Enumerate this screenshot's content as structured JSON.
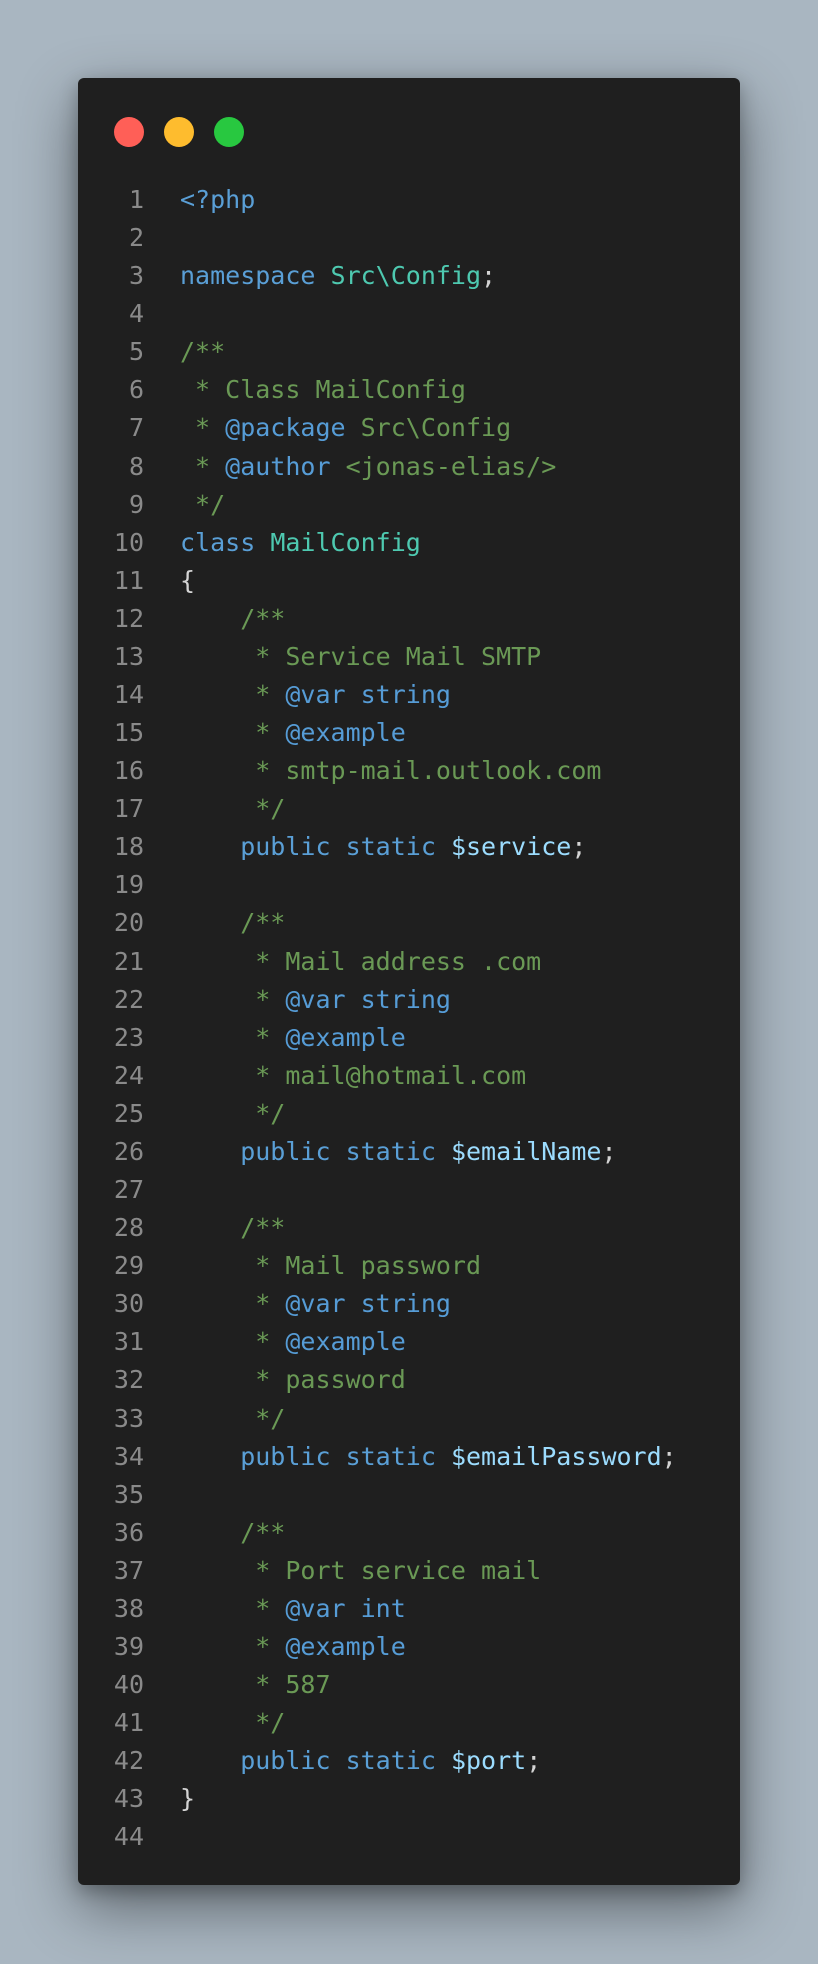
{
  "window": {
    "colors": {
      "page_background": "#a9b6c1",
      "editor_background": "#1f1f1f",
      "close": "#ff5f57",
      "minimize": "#febc2e",
      "zoom": "#28c840"
    }
  },
  "lines": [
    {
      "n": "1",
      "tokens": [
        {
          "t": "<?php",
          "c": "kw"
        }
      ]
    },
    {
      "n": "2",
      "tokens": []
    },
    {
      "n": "3",
      "tokens": [
        {
          "t": "namespace ",
          "c": "kw"
        },
        {
          "t": "Src\\Config",
          "c": "ns"
        },
        {
          "t": ";",
          "c": "pn"
        }
      ]
    },
    {
      "n": "4",
      "tokens": []
    },
    {
      "n": "5",
      "tokens": [
        {
          "t": "/**",
          "c": "cm"
        }
      ]
    },
    {
      "n": "6",
      "tokens": [
        {
          "t": " * Class MailConfig",
          "c": "cm"
        }
      ]
    },
    {
      "n": "7",
      "tokens": [
        {
          "t": " * ",
          "c": "cm"
        },
        {
          "t": "@package",
          "c": "tag"
        },
        {
          "t": " Src\\Config",
          "c": "cm"
        }
      ]
    },
    {
      "n": "8",
      "tokens": [
        {
          "t": " * ",
          "c": "cm"
        },
        {
          "t": "@author",
          "c": "tag"
        },
        {
          "t": " <jonas-elias/>",
          "c": "cm"
        }
      ]
    },
    {
      "n": "9",
      "tokens": [
        {
          "t": " */",
          "c": "cm"
        }
      ]
    },
    {
      "n": "10",
      "tokens": [
        {
          "t": "class ",
          "c": "kw"
        },
        {
          "t": "MailConfig",
          "c": "ns"
        }
      ]
    },
    {
      "n": "11",
      "tokens": [
        {
          "t": "{",
          "c": "pn"
        }
      ]
    },
    {
      "n": "12",
      "tokens": [
        {
          "t": "    /**",
          "c": "cm"
        }
      ]
    },
    {
      "n": "13",
      "tokens": [
        {
          "t": "     * Service Mail SMTP",
          "c": "cm"
        }
      ]
    },
    {
      "n": "14",
      "tokens": [
        {
          "t": "     * ",
          "c": "cm"
        },
        {
          "t": "@var",
          "c": "tag"
        },
        {
          "t": " string",
          "c": "tag"
        }
      ]
    },
    {
      "n": "15",
      "tokens": [
        {
          "t": "     * ",
          "c": "cm"
        },
        {
          "t": "@example",
          "c": "tag"
        }
      ]
    },
    {
      "n": "16",
      "tokens": [
        {
          "t": "     * smtp-mail.outlook.com",
          "c": "cm"
        }
      ]
    },
    {
      "n": "17",
      "tokens": [
        {
          "t": "     */",
          "c": "cm"
        }
      ]
    },
    {
      "n": "18",
      "tokens": [
        {
          "t": "    public static ",
          "c": "kw"
        },
        {
          "t": "$service",
          "c": "var"
        },
        {
          "t": ";",
          "c": "pn"
        }
      ]
    },
    {
      "n": "19",
      "tokens": []
    },
    {
      "n": "20",
      "tokens": [
        {
          "t": "    /**",
          "c": "cm"
        }
      ]
    },
    {
      "n": "21",
      "tokens": [
        {
          "t": "     * Mail address .com",
          "c": "cm"
        }
      ]
    },
    {
      "n": "22",
      "tokens": [
        {
          "t": "     * ",
          "c": "cm"
        },
        {
          "t": "@var",
          "c": "tag"
        },
        {
          "t": " string",
          "c": "tag"
        }
      ]
    },
    {
      "n": "23",
      "tokens": [
        {
          "t": "     * ",
          "c": "cm"
        },
        {
          "t": "@example",
          "c": "tag"
        }
      ]
    },
    {
      "n": "24",
      "tokens": [
        {
          "t": "     * mail@hotmail.com",
          "c": "cm"
        }
      ]
    },
    {
      "n": "25",
      "tokens": [
        {
          "t": "     */",
          "c": "cm"
        }
      ]
    },
    {
      "n": "26",
      "tokens": [
        {
          "t": "    public static ",
          "c": "kw"
        },
        {
          "t": "$emailName",
          "c": "var"
        },
        {
          "t": ";",
          "c": "pn"
        }
      ]
    },
    {
      "n": "27",
      "tokens": []
    },
    {
      "n": "28",
      "tokens": [
        {
          "t": "    /**",
          "c": "cm"
        }
      ]
    },
    {
      "n": "29",
      "tokens": [
        {
          "t": "     * Mail password",
          "c": "cm"
        }
      ]
    },
    {
      "n": "30",
      "tokens": [
        {
          "t": "     * ",
          "c": "cm"
        },
        {
          "t": "@var",
          "c": "tag"
        },
        {
          "t": " string",
          "c": "tag"
        }
      ]
    },
    {
      "n": "31",
      "tokens": [
        {
          "t": "     * ",
          "c": "cm"
        },
        {
          "t": "@example",
          "c": "tag"
        }
      ]
    },
    {
      "n": "32",
      "tokens": [
        {
          "t": "     * password",
          "c": "cm"
        }
      ]
    },
    {
      "n": "33",
      "tokens": [
        {
          "t": "     */",
          "c": "cm"
        }
      ]
    },
    {
      "n": "34",
      "tokens": [
        {
          "t": "    public static ",
          "c": "kw"
        },
        {
          "t": "$emailPassword",
          "c": "var"
        },
        {
          "t": ";",
          "c": "pn"
        }
      ]
    },
    {
      "n": "35",
      "tokens": []
    },
    {
      "n": "36",
      "tokens": [
        {
          "t": "    /**",
          "c": "cm"
        }
      ]
    },
    {
      "n": "37",
      "tokens": [
        {
          "t": "     * Port service mail",
          "c": "cm"
        }
      ]
    },
    {
      "n": "38",
      "tokens": [
        {
          "t": "     * ",
          "c": "cm"
        },
        {
          "t": "@var",
          "c": "tag"
        },
        {
          "t": " int",
          "c": "tag"
        }
      ]
    },
    {
      "n": "39",
      "tokens": [
        {
          "t": "     * ",
          "c": "cm"
        },
        {
          "t": "@example",
          "c": "tag"
        }
      ]
    },
    {
      "n": "40",
      "tokens": [
        {
          "t": "     * 587",
          "c": "cm"
        }
      ]
    },
    {
      "n": "41",
      "tokens": [
        {
          "t": "     */",
          "c": "cm"
        }
      ]
    },
    {
      "n": "42",
      "tokens": [
        {
          "t": "    public static ",
          "c": "kw"
        },
        {
          "t": "$port",
          "c": "var"
        },
        {
          "t": ";",
          "c": "pn"
        }
      ]
    },
    {
      "n": "43",
      "tokens": [
        {
          "t": "}",
          "c": "pn"
        }
      ]
    },
    {
      "n": "44",
      "tokens": []
    }
  ]
}
